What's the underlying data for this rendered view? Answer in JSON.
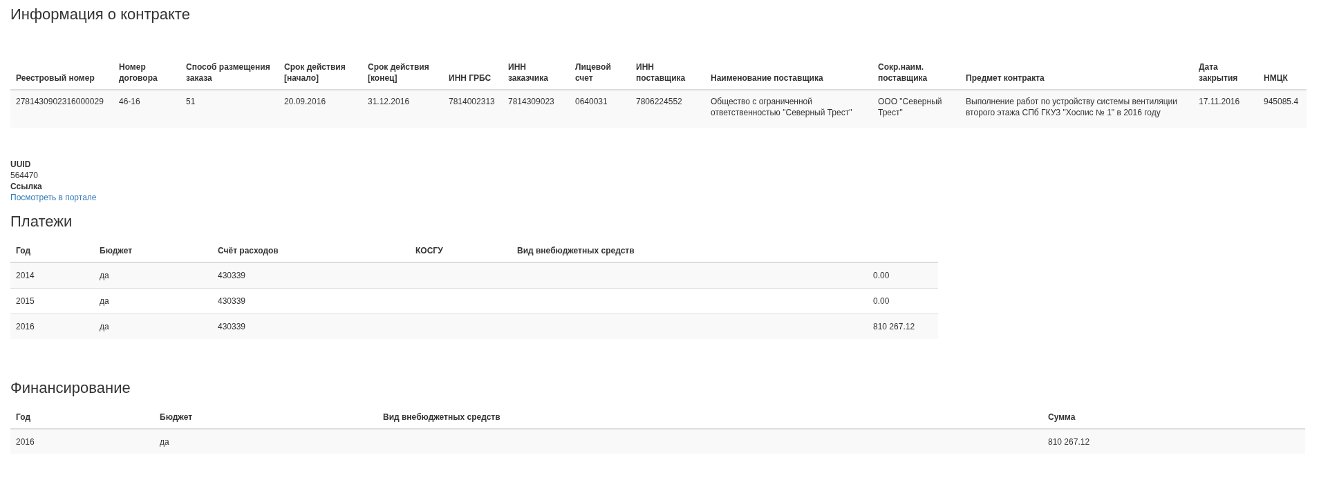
{
  "contract": {
    "title": "Информация о контракте",
    "table": {
      "columns": [
        "Реестровый номер",
        "Номер договора",
        "Способ размещения заказа",
        "Срок действия [начало]",
        "Срок действия [конец]",
        "ИНН ГРБС",
        "ИНН заказчика",
        "Лицевой счет",
        "ИНН поставщика",
        "Наименование поставщика",
        "Сокр.наим. поставщика",
        "Предмет контракта",
        "Дата закрытия",
        "НМЦК"
      ],
      "rows": [
        [
          "2781430902316000029",
          "46-16",
          "51",
          "20.09.2016",
          "31.12.2016",
          "7814002313",
          "7814309023",
          "0640031",
          "7806224552",
          "Общество с ограниченной ответственностью \"Северный Трест\"",
          "ООО \"Северный Трест\"",
          "Выполнение работ по устройству системы вентиляции второго этажа СПб ГКУЗ \"Хоспис № 1\" в 2016 году",
          "17.11.2016",
          "945085.4"
        ]
      ]
    }
  },
  "details": [
    {
      "label": "UUID",
      "value": "564470",
      "kind": "text"
    },
    {
      "label": "Ссылка",
      "value": "Посмотреть в портале",
      "kind": "link"
    }
  ],
  "payments": {
    "title": "Платежи",
    "table": {
      "columns": [
        "Год",
        "Бюджет",
        "Счёт расходов",
        "КОСГУ",
        "Вид внебюджетных средств",
        ""
      ],
      "rows": [
        [
          "2014",
          "да",
          "430339",
          "",
          "",
          "0.00"
        ],
        [
          "2015",
          "да",
          "430339",
          "",
          "",
          "0.00"
        ],
        [
          "2016",
          "да",
          "430339",
          "",
          "",
          "810 267.12"
        ]
      ]
    }
  },
  "financing": {
    "title": "Финансирование",
    "table": {
      "columns": [
        "Год",
        "Бюджет",
        "Вид внебюджетных средств",
        "Сумма"
      ],
      "rows": [
        [
          "2016",
          "да",
          "",
          "810 267.12"
        ]
      ]
    }
  }
}
